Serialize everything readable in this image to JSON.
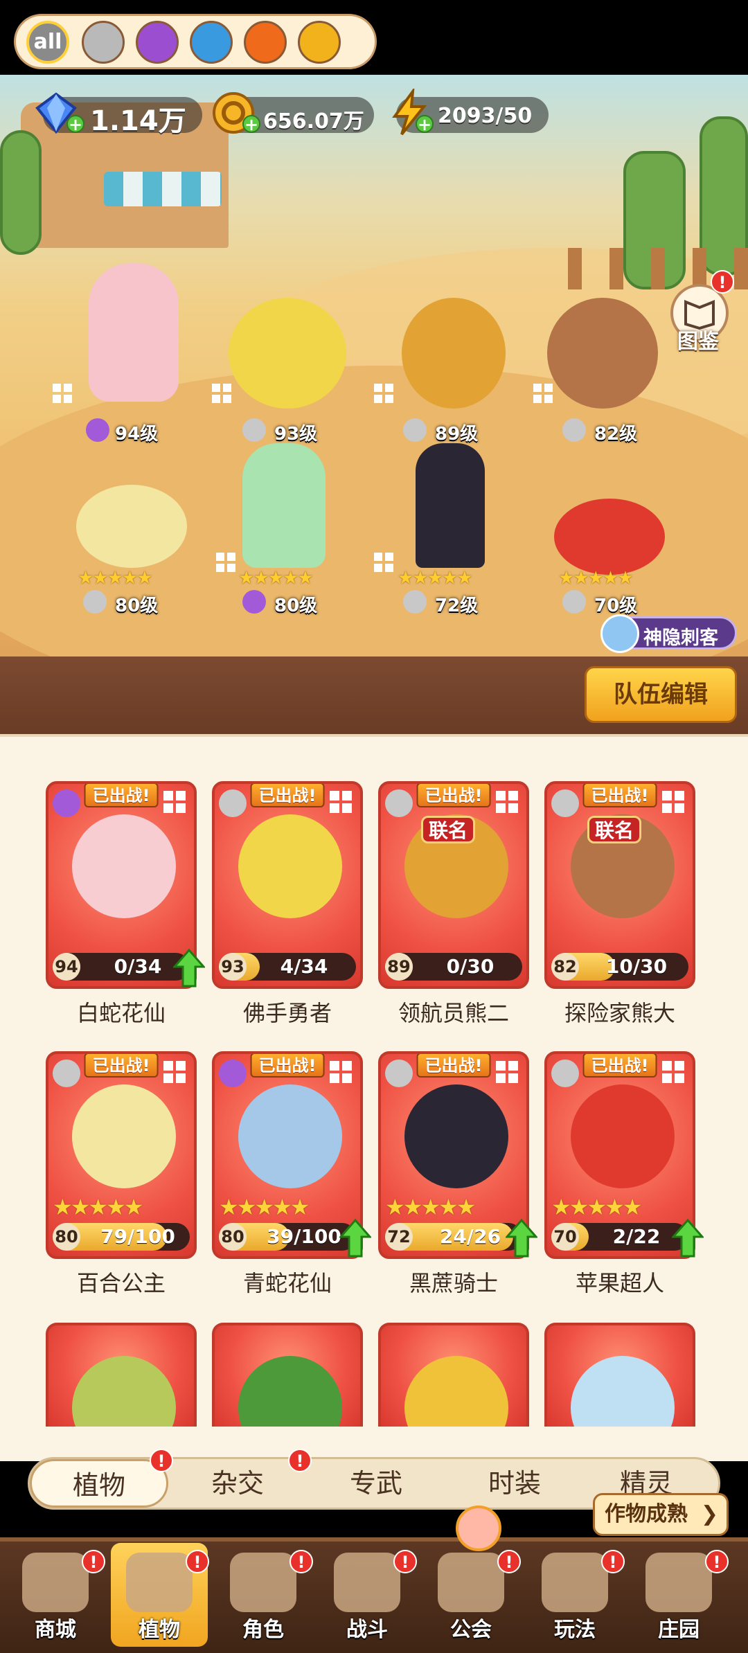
{
  "currencies": {
    "gems": "1.14万",
    "gold": "656.07万",
    "energy": "2093/50"
  },
  "scene": {
    "atlas_label": "图鉴",
    "atlas_badge": "!",
    "assassin_label": "神隐刺客",
    "heroes": [
      {
        "level": "94级",
        "element": "potion"
      },
      {
        "level": "93级",
        "element": "sword"
      },
      {
        "level": "89级",
        "element": "sword"
      },
      {
        "level": "82级",
        "element": "sword"
      },
      {
        "level": "80级",
        "element": "sword",
        "stars": "★★★★★"
      },
      {
        "level": "80级",
        "element": "potion",
        "stars": "★★★★★"
      },
      {
        "level": "72级",
        "element": "sword",
        "stars": "★★★★★"
      },
      {
        "level": "70级",
        "element": "sword",
        "stars": "★★★★★"
      }
    ]
  },
  "filters": {
    "all_label": "all",
    "icons": [
      "sword-icon",
      "potion-icon",
      "water-icon",
      "fire-icon",
      "lightning-icon"
    ]
  },
  "team_edit_label": "队伍编辑",
  "cards": [
    {
      "name": "白蛇花仙",
      "deployed": "已出战!",
      "level": "94",
      "progress": "0/34",
      "fill": 0.0,
      "upgrade": true,
      "collab": "",
      "stars": ""
    },
    {
      "name": "佛手勇者",
      "deployed": "已出战!",
      "level": "93",
      "progress": "4/34",
      "fill": 0.12,
      "upgrade": false,
      "collab": "",
      "stars": ""
    },
    {
      "name": "领航员熊二",
      "deployed": "已出战!",
      "level": "89",
      "progress": "0/30",
      "fill": 0.0,
      "upgrade": false,
      "collab": "联名",
      "stars": ""
    },
    {
      "name": "探险家熊大",
      "deployed": "已出战!",
      "level": "82",
      "progress": "10/30",
      "fill": 0.33,
      "upgrade": false,
      "collab": "联名",
      "stars": ""
    },
    {
      "name": "百合公主",
      "deployed": "已出战!",
      "level": "80",
      "progress": "79/100",
      "fill": 0.79,
      "upgrade": false,
      "collab": "",
      "stars": "★★★★★"
    },
    {
      "name": "青蛇花仙",
      "deployed": "已出战!",
      "level": "80",
      "progress": "39/100",
      "fill": 0.39,
      "upgrade": true,
      "collab": "",
      "stars": "★★★★★"
    },
    {
      "name": "黑蔗骑士",
      "deployed": "已出战!",
      "level": "72",
      "progress": "24/26",
      "fill": 0.92,
      "upgrade": true,
      "collab": "",
      "stars": "★★★★★"
    },
    {
      "name": "苹果超人",
      "deployed": "已出战!",
      "level": "70",
      "progress": "2/22",
      "fill": 0.09,
      "upgrade": true,
      "collab": "",
      "stars": "★★★★★"
    }
  ],
  "subtabs": [
    {
      "label": "植物",
      "active": true,
      "badge": "!"
    },
    {
      "label": "杂交",
      "active": false,
      "badge": "!"
    },
    {
      "label": "专武",
      "active": false,
      "badge": ""
    },
    {
      "label": "时装",
      "active": false,
      "badge": ""
    },
    {
      "label": "精灵",
      "active": false,
      "badge": ""
    }
  ],
  "crop_ripe_label": "作物成熟",
  "nav": [
    {
      "label": "商城",
      "active": false,
      "badge": "!"
    },
    {
      "label": "植物",
      "active": true,
      "badge": "!"
    },
    {
      "label": "角色",
      "active": false,
      "badge": "!"
    },
    {
      "label": "战斗",
      "active": false,
      "badge": "!"
    },
    {
      "label": "公会",
      "active": false,
      "badge": "!"
    },
    {
      "label": "玩法",
      "active": false,
      "badge": "!"
    },
    {
      "label": "庄园",
      "active": false,
      "badge": "!"
    }
  ],
  "colors": {
    "card_red": "#ef5245",
    "accent_yellow": "#f1a11e",
    "nav_brown": "#5c3823"
  }
}
